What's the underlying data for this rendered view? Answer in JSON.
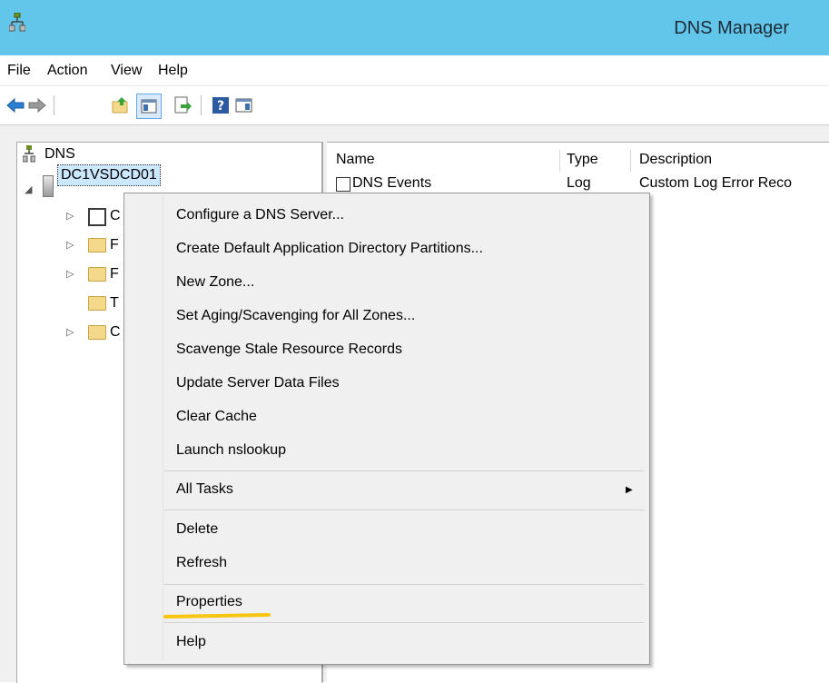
{
  "window": {
    "title": "DNS Manager"
  },
  "menubar": {
    "file": "File",
    "action": "Action",
    "view": "View",
    "help": "Help"
  },
  "toolbar": {
    "icons": [
      "back-arrow-icon",
      "forward-arrow-icon",
      "up-folder-icon",
      "show-hide-console-tree-icon",
      "export-list-icon",
      "help-icon",
      "show-hide-action-pane-icon"
    ]
  },
  "tree": {
    "root": "DNS",
    "server": "DC1VSDCD01",
    "children_partial": [
      "C",
      "F",
      "F",
      "T",
      "C"
    ]
  },
  "list": {
    "columns": [
      "Name",
      "Type",
      "Description"
    ],
    "rows": [
      {
        "name": "DNS Events",
        "type": "Log",
        "description": "Custom Log Error Reco"
      }
    ]
  },
  "context_menu": {
    "group1": [
      "Configure a DNS Server...",
      "Create Default Application Directory Partitions...",
      "New Zone...",
      "Set Aging/Scavenging for All Zones...",
      "Scavenge Stale Resource Records",
      "Update Server Data Files",
      "Clear Cache",
      "Launch nslookup"
    ],
    "all_tasks": "All Tasks",
    "delete": "Delete",
    "refresh": "Refresh",
    "properties": "Properties",
    "help": "Help"
  },
  "colors": {
    "titlebar": "#62c6eb",
    "highlight_underline": "#f8c511"
  }
}
